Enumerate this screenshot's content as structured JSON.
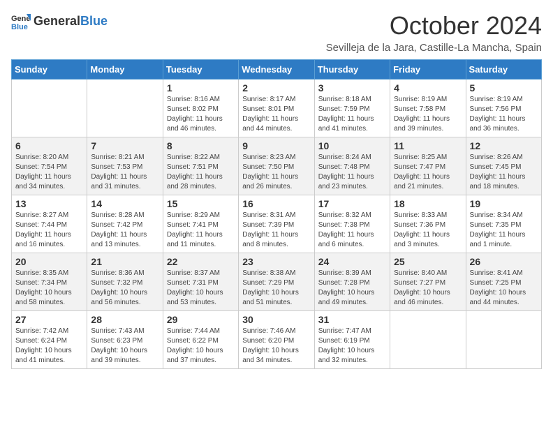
{
  "header": {
    "logo_general": "General",
    "logo_blue": "Blue",
    "month_title": "October 2024",
    "location": "Sevilleja de la Jara, Castille-La Mancha, Spain"
  },
  "weekdays": [
    "Sunday",
    "Monday",
    "Tuesday",
    "Wednesday",
    "Thursday",
    "Friday",
    "Saturday"
  ],
  "weeks": [
    [
      {
        "day": "",
        "info": ""
      },
      {
        "day": "",
        "info": ""
      },
      {
        "day": "1",
        "info": "Sunrise: 8:16 AM\nSunset: 8:02 PM\nDaylight: 11 hours and 46 minutes."
      },
      {
        "day": "2",
        "info": "Sunrise: 8:17 AM\nSunset: 8:01 PM\nDaylight: 11 hours and 44 minutes."
      },
      {
        "day": "3",
        "info": "Sunrise: 8:18 AM\nSunset: 7:59 PM\nDaylight: 11 hours and 41 minutes."
      },
      {
        "day": "4",
        "info": "Sunrise: 8:19 AM\nSunset: 7:58 PM\nDaylight: 11 hours and 39 minutes."
      },
      {
        "day": "5",
        "info": "Sunrise: 8:19 AM\nSunset: 7:56 PM\nDaylight: 11 hours and 36 minutes."
      }
    ],
    [
      {
        "day": "6",
        "info": "Sunrise: 8:20 AM\nSunset: 7:54 PM\nDaylight: 11 hours and 34 minutes."
      },
      {
        "day": "7",
        "info": "Sunrise: 8:21 AM\nSunset: 7:53 PM\nDaylight: 11 hours and 31 minutes."
      },
      {
        "day": "8",
        "info": "Sunrise: 8:22 AM\nSunset: 7:51 PM\nDaylight: 11 hours and 28 minutes."
      },
      {
        "day": "9",
        "info": "Sunrise: 8:23 AM\nSunset: 7:50 PM\nDaylight: 11 hours and 26 minutes."
      },
      {
        "day": "10",
        "info": "Sunrise: 8:24 AM\nSunset: 7:48 PM\nDaylight: 11 hours and 23 minutes."
      },
      {
        "day": "11",
        "info": "Sunrise: 8:25 AM\nSunset: 7:47 PM\nDaylight: 11 hours and 21 minutes."
      },
      {
        "day": "12",
        "info": "Sunrise: 8:26 AM\nSunset: 7:45 PM\nDaylight: 11 hours and 18 minutes."
      }
    ],
    [
      {
        "day": "13",
        "info": "Sunrise: 8:27 AM\nSunset: 7:44 PM\nDaylight: 11 hours and 16 minutes."
      },
      {
        "day": "14",
        "info": "Sunrise: 8:28 AM\nSunset: 7:42 PM\nDaylight: 11 hours and 13 minutes."
      },
      {
        "day": "15",
        "info": "Sunrise: 8:29 AM\nSunset: 7:41 PM\nDaylight: 11 hours and 11 minutes."
      },
      {
        "day": "16",
        "info": "Sunrise: 8:31 AM\nSunset: 7:39 PM\nDaylight: 11 hours and 8 minutes."
      },
      {
        "day": "17",
        "info": "Sunrise: 8:32 AM\nSunset: 7:38 PM\nDaylight: 11 hours and 6 minutes."
      },
      {
        "day": "18",
        "info": "Sunrise: 8:33 AM\nSunset: 7:36 PM\nDaylight: 11 hours and 3 minutes."
      },
      {
        "day": "19",
        "info": "Sunrise: 8:34 AM\nSunset: 7:35 PM\nDaylight: 11 hours and 1 minute."
      }
    ],
    [
      {
        "day": "20",
        "info": "Sunrise: 8:35 AM\nSunset: 7:34 PM\nDaylight: 10 hours and 58 minutes."
      },
      {
        "day": "21",
        "info": "Sunrise: 8:36 AM\nSunset: 7:32 PM\nDaylight: 10 hours and 56 minutes."
      },
      {
        "day": "22",
        "info": "Sunrise: 8:37 AM\nSunset: 7:31 PM\nDaylight: 10 hours and 53 minutes."
      },
      {
        "day": "23",
        "info": "Sunrise: 8:38 AM\nSunset: 7:29 PM\nDaylight: 10 hours and 51 minutes."
      },
      {
        "day": "24",
        "info": "Sunrise: 8:39 AM\nSunset: 7:28 PM\nDaylight: 10 hours and 49 minutes."
      },
      {
        "day": "25",
        "info": "Sunrise: 8:40 AM\nSunset: 7:27 PM\nDaylight: 10 hours and 46 minutes."
      },
      {
        "day": "26",
        "info": "Sunrise: 8:41 AM\nSunset: 7:25 PM\nDaylight: 10 hours and 44 minutes."
      }
    ],
    [
      {
        "day": "27",
        "info": "Sunrise: 7:42 AM\nSunset: 6:24 PM\nDaylight: 10 hours and 41 minutes."
      },
      {
        "day": "28",
        "info": "Sunrise: 7:43 AM\nSunset: 6:23 PM\nDaylight: 10 hours and 39 minutes."
      },
      {
        "day": "29",
        "info": "Sunrise: 7:44 AM\nSunset: 6:22 PM\nDaylight: 10 hours and 37 minutes."
      },
      {
        "day": "30",
        "info": "Sunrise: 7:46 AM\nSunset: 6:20 PM\nDaylight: 10 hours and 34 minutes."
      },
      {
        "day": "31",
        "info": "Sunrise: 7:47 AM\nSunset: 6:19 PM\nDaylight: 10 hours and 32 minutes."
      },
      {
        "day": "",
        "info": ""
      },
      {
        "day": "",
        "info": ""
      }
    ]
  ]
}
